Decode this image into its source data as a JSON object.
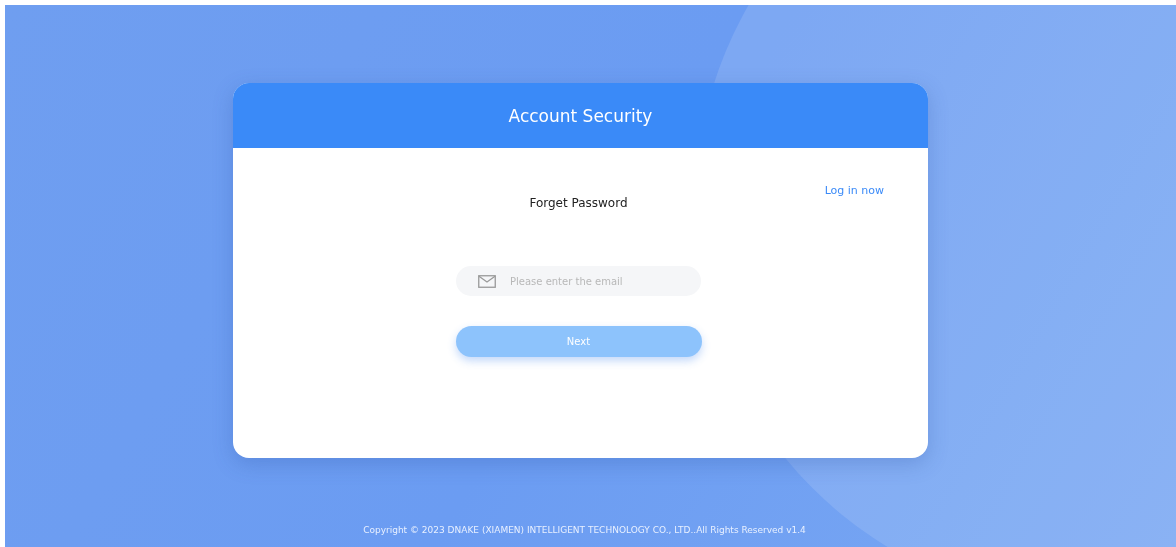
{
  "card": {
    "title": "Account Security",
    "login_link": "Log in now",
    "heading": "Forget Password"
  },
  "email_field": {
    "placeholder": "Please enter the email"
  },
  "next_button": {
    "label": "Next",
    "disabled": true
  },
  "footer": "Copyright © 2023 DNAKE (XIAMEN) INTELLIGENT TECHNOLOGY CO., LTD..All Rights Reserved v1.4"
}
